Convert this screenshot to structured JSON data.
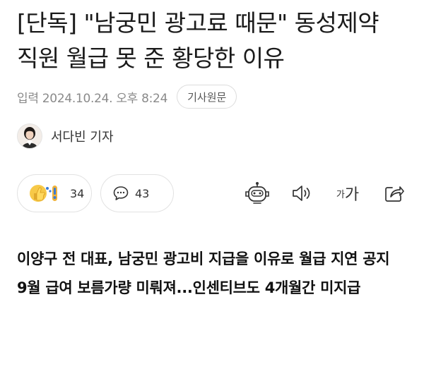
{
  "article": {
    "headline": "[단독] \"남궁민 광고료 때문\" 동성제약 직원 월급 못 준 황당한 이유",
    "meta": {
      "date_text": "입력 2024.10.24. 오후 8:24",
      "original_button": "기사원문"
    },
    "author": {
      "name": "서다빈 기자",
      "avatar_icon": "reporter-photo"
    },
    "actions": {
      "reaction": {
        "icon": "thumbs-up-emoji-icon",
        "count": "34"
      },
      "comment": {
        "icon": "speech-bubble-icon",
        "count": "43"
      },
      "tools": [
        {
          "icon": "robot-summary-icon"
        },
        {
          "icon": "speaker-icon"
        },
        {
          "icon": "font-size-icon",
          "small": "가",
          "large": "가"
        },
        {
          "icon": "share-icon"
        }
      ]
    },
    "summary": [
      "이양구 전 대표, 남궁민 광고비 지급을 이유로 월급 지연 공지",
      "9월 급여 보름가량 미뤄져...인센티브도 4개월간 미지급"
    ]
  },
  "colors": {
    "text": "#111111",
    "meta": "#8a8a8a",
    "border": "#e2e2e2",
    "emoji_yellow": "#f7c948",
    "emoji_blue": "#3a7bd5"
  }
}
